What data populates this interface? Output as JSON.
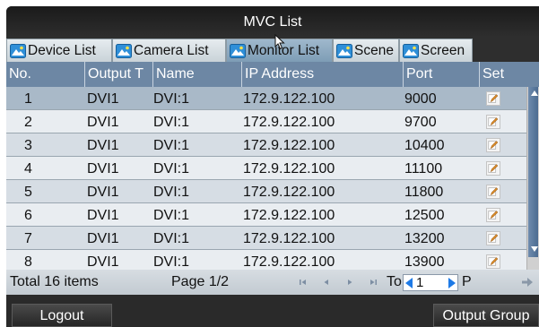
{
  "window": {
    "title": "MVC List"
  },
  "tabs": [
    {
      "label": "Device List",
      "icon": "device-list-icon"
    },
    {
      "label": "Camera List",
      "icon": "camera-list-icon"
    },
    {
      "label": "Monitor List",
      "icon": "monitor-list-icon",
      "active": true
    },
    {
      "label": "Scene",
      "icon": "scene-icon"
    },
    {
      "label": "Screen",
      "icon": "screen-icon"
    }
  ],
  "table": {
    "columns": [
      "No.",
      "Output T",
      "Name",
      "IP Address",
      "Port",
      "Set"
    ],
    "rows": [
      {
        "no": "1",
        "output_type": "DVI1",
        "name": "DVI:1",
        "ip": "172.9.122.100",
        "port": "9000"
      },
      {
        "no": "2",
        "output_type": "DVI1",
        "name": "DVI:1",
        "ip": "172.9.122.100",
        "port": "9700"
      },
      {
        "no": "3",
        "output_type": "DVI1",
        "name": "DVI:1",
        "ip": "172.9.122.100",
        "port": "10400"
      },
      {
        "no": "4",
        "output_type": "DVI1",
        "name": "DVI:1",
        "ip": "172.9.122.100",
        "port": "11100"
      },
      {
        "no": "5",
        "output_type": "DVI1",
        "name": "DVI:1",
        "ip": "172.9.122.100",
        "port": "11800"
      },
      {
        "no": "6",
        "output_type": "DVI1",
        "name": "DVI:1",
        "ip": "172.9.122.100",
        "port": "12500"
      },
      {
        "no": "7",
        "output_type": "DVI1",
        "name": "DVI:1",
        "ip": "172.9.122.100",
        "port": "13200"
      },
      {
        "no": "8",
        "output_type": "DVI1",
        "name": "DVI:1",
        "ip": "172.9.122.100",
        "port": "13900"
      }
    ],
    "selected_row": 0
  },
  "pagination": {
    "total": "Total 16 items",
    "page": "Page 1/2",
    "goto_label": "To",
    "goto_value": "1",
    "goto_suffix": "P"
  },
  "buttons": {
    "logout": "Logout",
    "output_group": "Output Group"
  },
  "colors": {
    "header": "#6d87a4",
    "selected_row": "#a9b9c8",
    "accent_blue": "#1e7ae6"
  }
}
